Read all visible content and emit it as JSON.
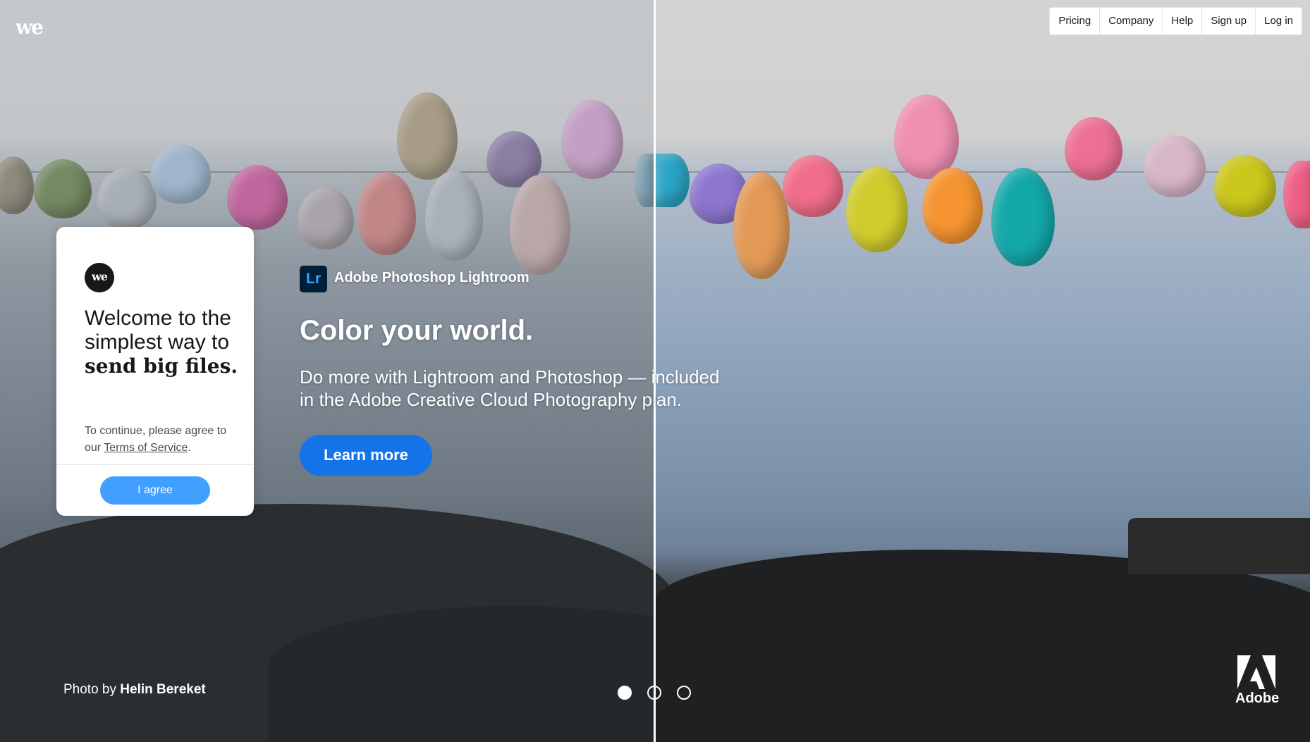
{
  "brand": {
    "logo_text": "we"
  },
  "nav": {
    "items": [
      {
        "label": "Pricing"
      },
      {
        "label": "Company"
      },
      {
        "label": "Help"
      },
      {
        "label": "Sign up"
      },
      {
        "label": "Log in"
      }
    ]
  },
  "welcome_card": {
    "logo_text": "we",
    "title_regular": "Welcome to the simplest way to ",
    "title_bold": "send big files.",
    "consent_prefix": "To continue, please agree to our ",
    "terms_link": "Terms of Service",
    "consent_suffix": ".",
    "agree_button": "I agree"
  },
  "ad": {
    "product_badge": "Lr",
    "product_name": "Adobe Photoshop Lightroom",
    "headline": "Color your world.",
    "subtext": "Do more with Lightroom and Photoshop — included in the Adobe Creative Cloud Photography plan.",
    "cta_label": "Learn more",
    "advertiser": "Adobe"
  },
  "footer": {
    "photo_by_prefix": "Photo by ",
    "photographer": "Helin Bereket"
  },
  "carousel": {
    "count": 3,
    "active_index": 0
  },
  "colors": {
    "agree_button": "#409fff",
    "cta_button": "#1473e6",
    "lightroom_badge_bg": "#001e36",
    "lightroom_badge_text": "#31a8ff"
  },
  "icons": {
    "brand_logo": "wetransfer-logo-icon",
    "advertiser_logo": "adobe-logo-icon"
  }
}
